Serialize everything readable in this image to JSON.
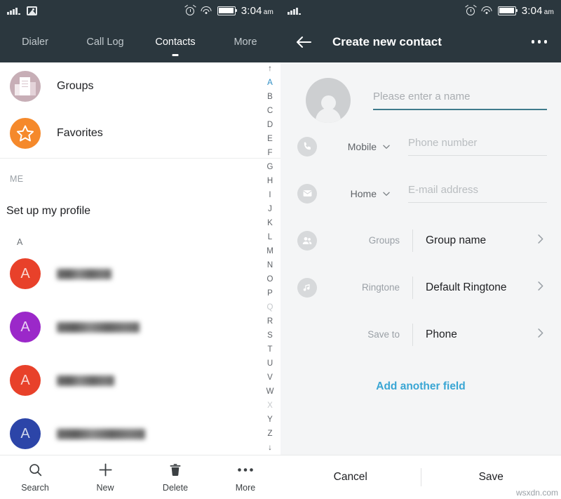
{
  "status_bar": {
    "time": "3:04",
    "ampm": "am",
    "icons": [
      "signal-bars-icon",
      "photo-icon",
      "alarm-icon",
      "wifi-icon",
      "battery-icon"
    ]
  },
  "left": {
    "tabs": [
      {
        "label": "Dialer",
        "active": false
      },
      {
        "label": "Call Log",
        "active": false
      },
      {
        "label": "Contacts",
        "active": true
      },
      {
        "label": "More",
        "active": false
      }
    ],
    "shortcuts": [
      {
        "label": "Groups",
        "icon": "groups-icon",
        "color": "#c7aeb6"
      },
      {
        "label": "Favorites",
        "icon": "star-icon",
        "color": "#f5892b"
      }
    ],
    "me_section_header": "ME",
    "me_row_label": "Set up my profile",
    "letter_header": "A",
    "contacts": [
      {
        "initial": "A",
        "color": "#e8412a",
        "name_redacted": true,
        "name_width": 78
      },
      {
        "initial": "A",
        "color": "#9b28c9",
        "name_redacted": true,
        "name_width": 118
      },
      {
        "initial": "A",
        "color": "#e8412a",
        "name_redacted": true,
        "name_width": 82
      },
      {
        "initial": "A",
        "color": "#2c45a8",
        "name_redacted": true,
        "name_width": 126
      }
    ],
    "alpha_index": {
      "top_arrow": "↑",
      "bottom_arrow": "↓",
      "letters": [
        "A",
        "B",
        "C",
        "D",
        "E",
        "F",
        "G",
        "H",
        "I",
        "J",
        "K",
        "L",
        "M",
        "N",
        "O",
        "P",
        "Q",
        "R",
        "S",
        "T",
        "U",
        "V",
        "W",
        "X",
        "Y",
        "Z"
      ],
      "highlighted": "A",
      "dimmed": [
        "Q",
        "X"
      ],
      "highlight_color": "#2f8ec4"
    },
    "bottom_bar": [
      {
        "label": "Search",
        "icon": "search-icon"
      },
      {
        "label": "New",
        "icon": "plus-icon"
      },
      {
        "label": "Delete",
        "icon": "trash-icon"
      },
      {
        "label": "More",
        "icon": "more-horizontal-icon"
      }
    ]
  },
  "right": {
    "header": {
      "back_icon": "arrow-left-icon",
      "title": "Create new contact",
      "menu_icon": "more-horizontal-icon"
    },
    "name": {
      "avatar_icon": "person-placeholder-icon",
      "placeholder": "Please enter a name",
      "value": "",
      "expand_icon": "chevron-down-icon",
      "underline_color": "#3f7b8c"
    },
    "fields": [
      {
        "icon": "phone-icon",
        "type": "Mobile",
        "placeholder": "Phone number",
        "value": ""
      },
      {
        "icon": "mail-icon",
        "type": "Home",
        "placeholder": "E-mail address",
        "value": ""
      }
    ],
    "selectors": [
      {
        "icon": "people-icon",
        "label": "Groups",
        "value": "Group name",
        "chevron": "chevron-right-icon"
      },
      {
        "icon": "music-note-icon",
        "label": "Ringtone",
        "value": "Default Ringtone",
        "chevron": "chevron-right-icon"
      },
      {
        "icon": null,
        "label": "Save to",
        "value": "Phone",
        "chevron": "chevron-right-icon"
      }
    ],
    "add_field_label": "Add another field",
    "add_field_color": "#3aa6d4",
    "bottom_bar": [
      {
        "label": "Cancel"
      },
      {
        "label": "Save"
      }
    ]
  },
  "watermark": "wsxdn.com"
}
